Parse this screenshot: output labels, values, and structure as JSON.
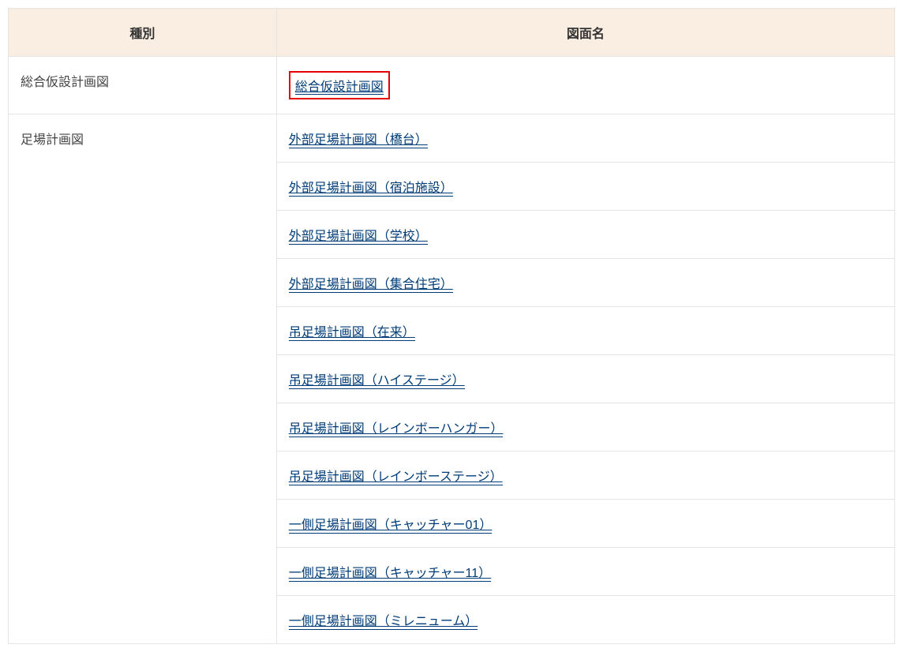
{
  "header": {
    "col_type": "種別",
    "col_name": "図面名"
  },
  "rows": [
    {
      "type": "総合仮設計画図",
      "links": [
        "総合仮設計画図"
      ],
      "highlighted": true
    },
    {
      "type": "足場計画図",
      "links": [
        "外部足場計画図（橋台）",
        "外部足場計画図（宿泊施設）",
        "外部足場計画図（学校）",
        "外部足場計画図（集合住宅）",
        "吊足場計画図（在来）",
        "吊足場計画図（ハイステージ）",
        "吊足場計画図（レインボーハンガー）",
        "吊足場計画図（レインボーステージ）",
        "一側足場計画図（キャッチャー01）",
        "一側足場計画図（キャッチャー11）",
        "一側足場計画図（ミレニューム）"
      ],
      "highlighted": false
    }
  ]
}
